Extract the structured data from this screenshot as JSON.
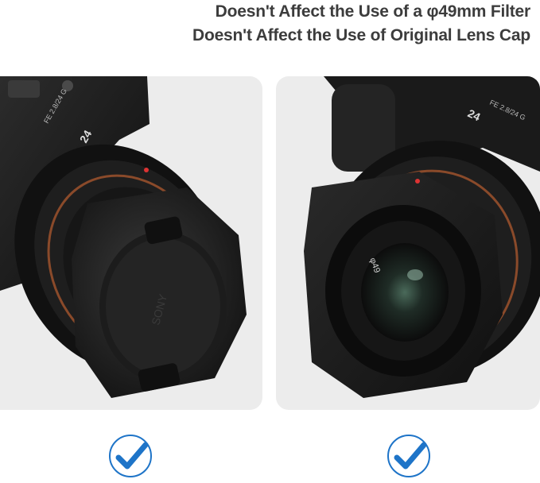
{
  "headline": {
    "line1": "Doesn't Affect the Use of a φ49mm Filter",
    "line2": "Doesn't Affect the Use of Original Lens Cap"
  },
  "panels": [
    {
      "name": "lens-cap-panel",
      "lens_text": "FE 2.8/24 G",
      "focal": "24"
    },
    {
      "name": "filter-panel",
      "lens_text": "FE 2.8/24 G",
      "focal": "24",
      "filter_mark": "φ49"
    }
  ],
  "colors": {
    "panel_bg": "#ececec",
    "check_blue": "#1e74c8",
    "headline": "#3c3c3c"
  },
  "icons": [
    "check-circle-icon",
    "check-circle-icon"
  ]
}
